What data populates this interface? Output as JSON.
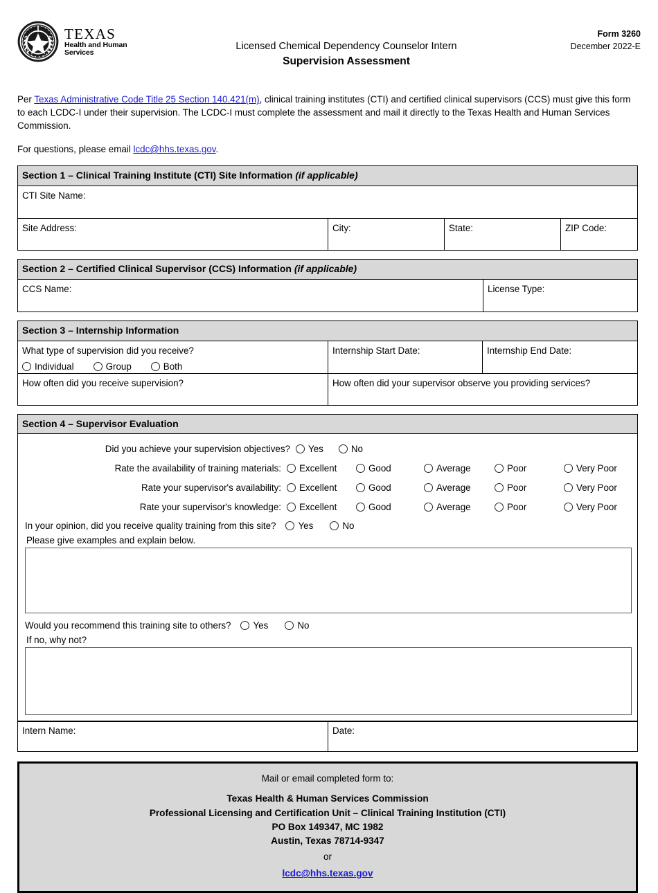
{
  "header": {
    "logo_texas": "TEXAS",
    "logo_sub_line1": "Health and Human",
    "logo_sub_line2": "Services",
    "logo_icon_name": "texas-state-seal",
    "title_line1": "Licensed Chemical Dependency Counselor Intern",
    "title_line2": "Supervision Assessment",
    "form_number": "Form 3260",
    "form_date": "December 2022-E"
  },
  "intro": {
    "p1_before_link": "Per ",
    "p1_link": "Texas Administrative Code Title 25 Section 140.421(m)",
    "p1_after_link": ", clinical training institutes (CTI) and certified clinical supervisors (CCS) must give this form to each LCDC-I under their supervision. The LCDC-I must complete the assessment and mail it directly to the Texas Health and Human Services Commission.",
    "p2_before_link": "For questions, please email ",
    "p2_link": "lcdc@hhs.texas.gov",
    "p2_after_link": "."
  },
  "section1": {
    "heading_main": "Section 1 – Clinical Training Institute (CTI) Site Information ",
    "heading_italic": "(if applicable)",
    "site_name_label": "CTI Site Name:",
    "address_label": "Site Address:",
    "city_label": "City:",
    "state_label": "State:",
    "zip_label": "ZIP Code:"
  },
  "section2": {
    "heading_main": "Section 2 – Certified Clinical Supervisor (CCS) Information ",
    "heading_italic": "(if applicable)",
    "ccs_name_label": "CCS Name:",
    "license_type_label": "License Type:"
  },
  "section3": {
    "heading_main": "Section 3 – Internship Information",
    "supervision_type_question": "What type of supervision did you receive?",
    "supervision_type_options": [
      "Individual",
      "Group",
      "Both"
    ],
    "start_date_label": "Internship Start Date:",
    "end_date_label": "Internship End Date:",
    "how_often_receive_label": "How often did you receive supervision?",
    "how_often_observe_label": "How often did your supervisor observe you providing services?"
  },
  "section4": {
    "heading_main": "Section 4 – Supervisor Evaluation",
    "objectives_question": "Did you achieve your supervision objectives?",
    "yes_no_options": [
      "Yes",
      "No"
    ],
    "rating_options": [
      "Excellent",
      "Good",
      "Average",
      "Poor",
      "Very Poor"
    ],
    "rating_questions": [
      "Rate the availability of training materials:",
      "Rate your supervisor's availability:",
      "Rate your supervisor's knowledge:"
    ],
    "quality_question": "In your opinion, did you receive quality training from this site?",
    "examples_label": "Please give examples and explain below.",
    "recommend_question": "Would you recommend this training site to others?",
    "if_no_label": "If no, why not?",
    "intern_name_label": "Intern Name:",
    "date_label": "Date:"
  },
  "footer": {
    "lead": "Mail or email completed form to:",
    "org_line1": "Texas Health & Human Services Commission",
    "org_line2": "Professional Licensing and Certification Unit – Clinical Training Institution (CTI)",
    "org_line3": "PO Box 149347, MC 1982",
    "org_line4": "Austin, Texas 78714-9347",
    "or_text": "or",
    "email": "lcdc@hhs.texas.gov"
  },
  "colors": {
    "section_header_bg": "#d8d8d8",
    "link": "#1a1ad6",
    "border": "#000000"
  }
}
